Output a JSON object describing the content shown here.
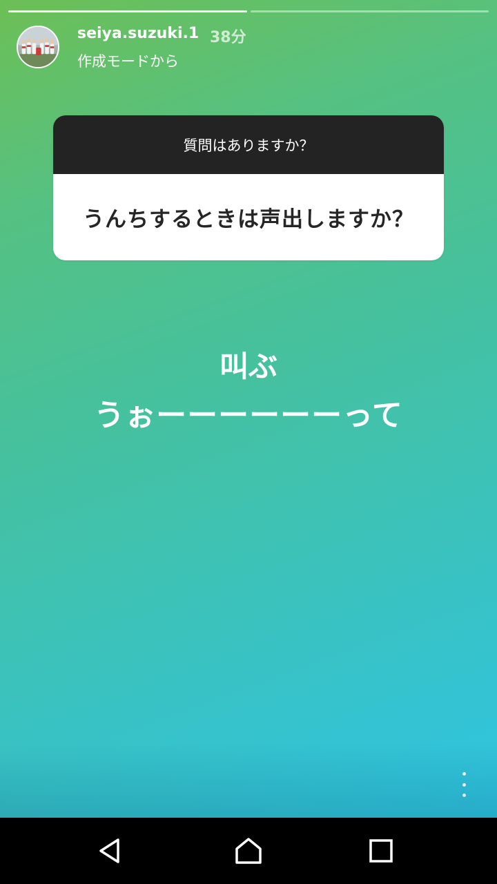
{
  "story": {
    "progress": {
      "total_segments": 2,
      "completed_segments": 1,
      "current_progress": 1.0
    },
    "header": {
      "username": "seiya.suzuki.1",
      "time_ago": "38分",
      "subtitle": "作成モードから"
    },
    "question_card": {
      "title": "質問はありますか？",
      "question": "うんちするときは声出しますか？"
    },
    "answer": {
      "line1": "叫ぶ",
      "line2": "うぉーーーーーーって"
    },
    "colors": {
      "gradient_start": "#6dbf55",
      "gradient_end": "#2ec4e3",
      "card_header": "#232323",
      "card_body": "#ffffff"
    }
  },
  "icons": {
    "more": "more-vertical-icon",
    "back": "back-triangle-icon",
    "home": "home-icon",
    "recent": "recent-apps-icon"
  }
}
